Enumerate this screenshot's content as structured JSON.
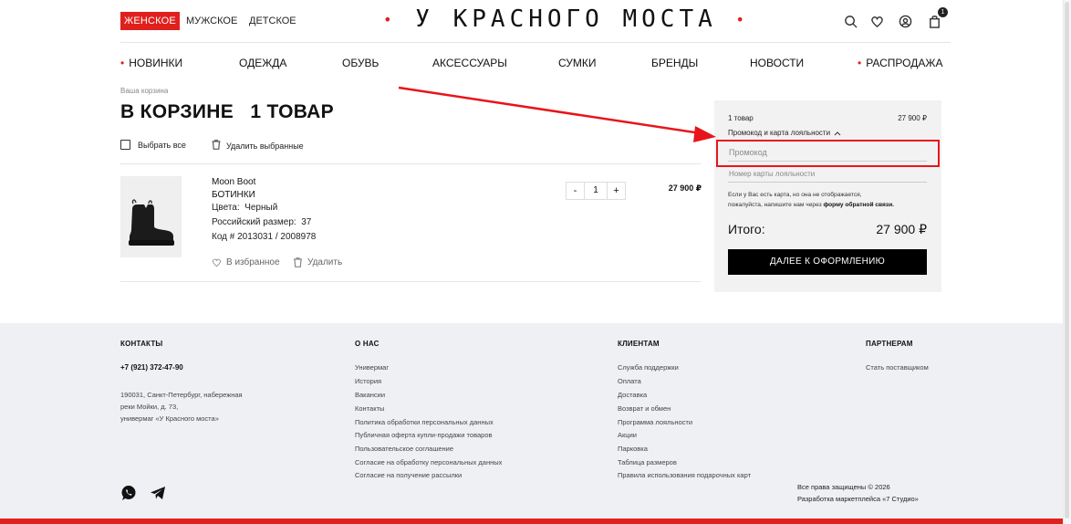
{
  "header": {
    "genders": [
      "ЖЕНСКОЕ",
      "МУЖСКОЕ",
      "ДЕТСКОЕ"
    ],
    "logo": "У КРАСНОГО МОСТА",
    "cart_count": "1",
    "icons": [
      "search-icon",
      "heart-icon",
      "user-icon",
      "bag-icon"
    ]
  },
  "nav": [
    "НОВИНКИ",
    "ОДЕЖДА",
    "ОБУВЬ",
    "АКСЕССУАРЫ",
    "СУМКИ",
    "БРЕНДЫ",
    "НОВОСТИ",
    "РАСПРОДАЖА"
  ],
  "cart": {
    "breadcrumb": "Ваша корзина",
    "title": "В КОРЗИНЕ   1 ТОВАР",
    "select_all": "Выбрать все",
    "delete_selected": "Удалить выбранные",
    "item": {
      "brand": "Moon Boot",
      "name": "БОТИНКИ",
      "color_label": "Цвета:",
      "color_value": "Черный",
      "size_label": "Российский размер:",
      "size_value": "37",
      "code": "Код # 2013031 / 2008978",
      "favorite": "В избранное",
      "delete": "Удалить",
      "qty_minus": "-",
      "qty": "1",
      "qty_plus": "+",
      "price": "27 900 ₽",
      "selected": true
    }
  },
  "summary": {
    "count": "1 товар",
    "subtotal": "27 900 ₽",
    "promo_toggle": "Промокод и карта лояльности",
    "promo_placeholder": "Промокод",
    "loyalty_placeholder": "Номер карты лояльности",
    "loyalty_note_1": "Если у Вас есть карта, но она не отображается,",
    "loyalty_note_2": "пожалуйста, напишите нам через",
    "loyalty_note_link": "форму обратной связи.",
    "total_label": "Итого:",
    "total_value": "27 900 ₽",
    "checkout": "ДАЛЕЕ К ОФОРМЛЕНИЮ"
  },
  "footer": {
    "contacts_head": "КОНТАКТЫ",
    "phone": "+7 (921) 372-47-90",
    "address_1": "190031, Санкт-Петербург, набережная",
    "address_2": "реки Мойки, д. 73,",
    "address_3": "универмаг «У Красного моста»",
    "about_head": "О НАС",
    "about_links": [
      "Универмаг",
      "История",
      "Вакансии",
      "Контакты",
      "Политика обработки персональных данных",
      "Публичная оферта купли-продажи товаров",
      "Пользовательское соглашение",
      "Согласие на обработку персональных данных",
      "Согласие на получение рассылки"
    ],
    "clients_head": "КЛИЕНТАМ",
    "clients_links": [
      "Служба поддержки",
      "Оплата",
      "Доставка",
      "Возврат и обмен",
      "Программа лояльности",
      "Акции",
      "Парковка",
      "Таблица размеров",
      "Правила использования подарочных карт"
    ],
    "partners_head": "ПАРТНЕРАМ",
    "partners_links": [
      "Стать поставщиком"
    ],
    "copyright": "Все права защищены © 2026",
    "developer": "Разработка маркетплейса «7 Студио»"
  },
  "colors": {
    "accent": "#e0201c",
    "annotation": "#e8141b",
    "footer_bg": "#eef0f3",
    "summary_bg": "#f2f2f2"
  }
}
